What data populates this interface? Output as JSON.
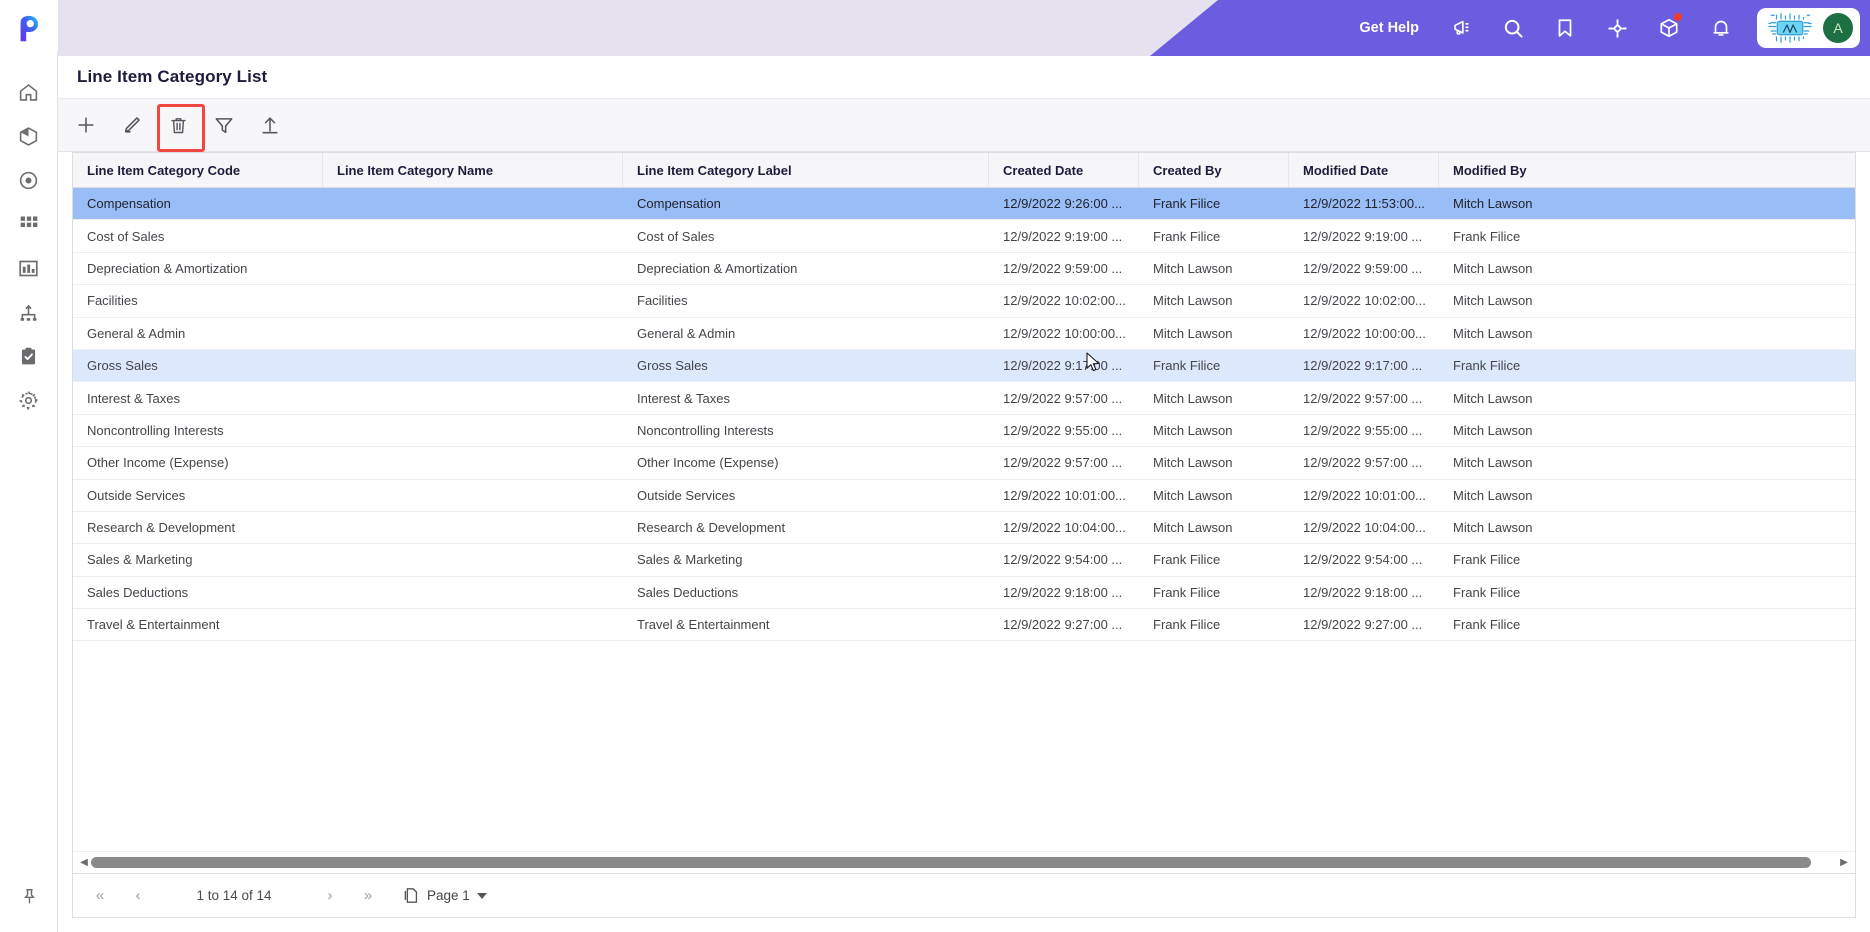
{
  "app": {
    "logo_icon": "pega-p-logo",
    "brand_color": "#6c5ce0"
  },
  "sidebar": {
    "items": [
      {
        "icon": "home-icon",
        "name": "home"
      },
      {
        "icon": "cube-icon",
        "name": "cases"
      },
      {
        "icon": "target-icon",
        "name": "target"
      },
      {
        "icon": "grid-icon",
        "name": "apps"
      },
      {
        "icon": "bar-chart-icon",
        "name": "reports"
      },
      {
        "icon": "hierarchy-icon",
        "name": "org"
      },
      {
        "icon": "clipboard-check-icon",
        "name": "tasks"
      },
      {
        "icon": "gear-icon",
        "name": "settings"
      }
    ],
    "pin_icon": "pin-icon"
  },
  "topbar": {
    "get_help_label": "Get Help",
    "icons": [
      {
        "icon": "megaphone-icon",
        "name": "announcements",
        "badge": false
      },
      {
        "icon": "search-icon",
        "name": "search",
        "badge": false
      },
      {
        "icon": "bookmark-icon",
        "name": "bookmarks",
        "badge": false
      },
      {
        "icon": "compass-icon",
        "name": "explore",
        "badge": false
      },
      {
        "icon": "package-icon",
        "name": "packages",
        "badge": true
      },
      {
        "icon": "bell-icon",
        "name": "notifications",
        "badge": false
      }
    ],
    "ai_chip_icon": "ai-chip-icon",
    "avatar_initial": "A",
    "avatar_color": "#1d7044"
  },
  "header": {
    "title": "Line Item Category List"
  },
  "toolbar": {
    "buttons": [
      {
        "icon": "plus-icon",
        "name": "add",
        "highlighted": false
      },
      {
        "icon": "pencil-icon",
        "name": "edit",
        "highlighted": false
      },
      {
        "icon": "trash-icon",
        "name": "delete",
        "highlighted": true
      },
      {
        "icon": "filter-icon",
        "name": "filter",
        "highlighted": false
      },
      {
        "icon": "upload-icon",
        "name": "export",
        "highlighted": false
      }
    ],
    "highlight_color": "#f0473e"
  },
  "grid": {
    "columns": [
      "Line Item Category Code",
      "Line Item Category Name",
      "Line Item Category Label",
      "Created Date",
      "Created By",
      "Modified Date",
      "Modified By"
    ],
    "selected_row_color": "#99bdf7",
    "hovered_row_color": "#dce8fc",
    "rows": [
      {
        "state": "selected",
        "cells": [
          "Compensation",
          "",
          "Compensation",
          "12/9/2022 9:26:00 ...",
          "Frank Filice",
          "12/9/2022 11:53:00...",
          "Mitch Lawson"
        ]
      },
      {
        "state": "normal",
        "cells": [
          "Cost of Sales",
          "",
          "Cost of Sales",
          "12/9/2022 9:19:00 ...",
          "Frank Filice",
          "12/9/2022 9:19:00 ...",
          "Frank Filice"
        ]
      },
      {
        "state": "normal",
        "cells": [
          "Depreciation & Amortization",
          "",
          "Depreciation & Amortization",
          "12/9/2022 9:59:00 ...",
          "Mitch Lawson",
          "12/9/2022 9:59:00 ...",
          "Mitch Lawson"
        ]
      },
      {
        "state": "normal",
        "cells": [
          "Facilities",
          "",
          "Facilities",
          "12/9/2022 10:02:00...",
          "Mitch Lawson",
          "12/9/2022 10:02:00...",
          "Mitch Lawson"
        ]
      },
      {
        "state": "normal",
        "cells": [
          "General & Admin",
          "",
          "General & Admin",
          "12/9/2022 10:00:00...",
          "Mitch Lawson",
          "12/9/2022 10:00:00...",
          "Mitch Lawson"
        ]
      },
      {
        "state": "hovered",
        "cells": [
          "Gross Sales",
          "",
          "Gross Sales",
          "12/9/2022 9:17:00 ...",
          "Frank Filice",
          "12/9/2022 9:17:00 ...",
          "Frank Filice"
        ]
      },
      {
        "state": "normal",
        "cells": [
          "Interest & Taxes",
          "",
          "Interest & Taxes",
          "12/9/2022 9:57:00 ...",
          "Mitch Lawson",
          "12/9/2022 9:57:00 ...",
          "Mitch Lawson"
        ]
      },
      {
        "state": "normal",
        "cells": [
          "Noncontrolling Interests",
          "",
          "Noncontrolling Interests",
          "12/9/2022 9:55:00 ...",
          "Mitch Lawson",
          "12/9/2022 9:55:00 ...",
          "Mitch Lawson"
        ]
      },
      {
        "state": "normal",
        "cells": [
          "Other Income (Expense)",
          "",
          "Other Income (Expense)",
          "12/9/2022 9:57:00 ...",
          "Mitch Lawson",
          "12/9/2022 9:57:00 ...",
          "Mitch Lawson"
        ]
      },
      {
        "state": "normal",
        "cells": [
          "Outside Services",
          "",
          "Outside Services",
          "12/9/2022 10:01:00...",
          "Mitch Lawson",
          "12/9/2022 10:01:00...",
          "Mitch Lawson"
        ]
      },
      {
        "state": "normal",
        "cells": [
          "Research & Development",
          "",
          "Research & Development",
          "12/9/2022 10:04:00...",
          "Mitch Lawson",
          "12/9/2022 10:04:00...",
          "Mitch Lawson"
        ]
      },
      {
        "state": "normal",
        "cells": [
          "Sales & Marketing",
          "",
          "Sales & Marketing",
          "12/9/2022 9:54:00 ...",
          "Frank Filice",
          "12/9/2022 9:54:00 ...",
          "Frank Filice"
        ]
      },
      {
        "state": "normal",
        "cells": [
          "Sales Deductions",
          "",
          "Sales Deductions",
          "12/9/2022 9:18:00 ...",
          "Frank Filice",
          "12/9/2022 9:18:00 ...",
          "Frank Filice"
        ]
      },
      {
        "state": "normal",
        "cells": [
          "Travel & Entertainment",
          "",
          "Travel & Entertainment",
          "12/9/2022 9:27:00 ...",
          "Frank Filice",
          "12/9/2022 9:27:00 ...",
          "Frank Filice"
        ]
      }
    ]
  },
  "pagination": {
    "first_label": "«",
    "prev_label": "‹",
    "range_label": "1 to 14 of 14",
    "next_label": "›",
    "last_label": "»",
    "page_icon": "pages-icon",
    "page_label": "Page 1"
  }
}
